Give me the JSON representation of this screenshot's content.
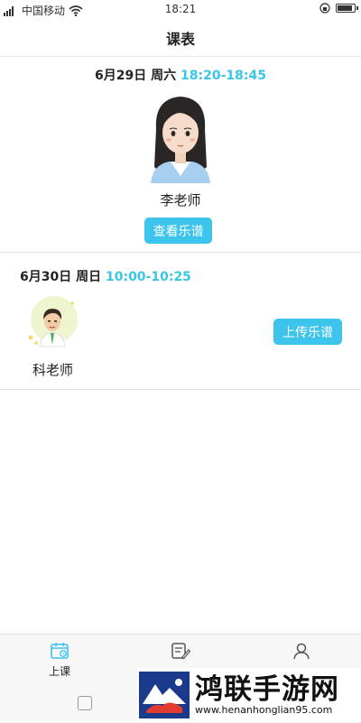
{
  "status": {
    "carrier": "中国移动",
    "time": "18:21"
  },
  "header": {
    "title": "课表"
  },
  "lessons": [
    {
      "date": "6月29日 周六",
      "time": "18:20-18:45",
      "teacher": "李老师",
      "action": "查看乐谱"
    },
    {
      "date": "6月30日 周日",
      "time": "10:00-10:25",
      "teacher": "科老师",
      "action": "上传乐谱"
    }
  ],
  "nav": {
    "items": [
      {
        "label": "上课",
        "icon": "calendar-icon",
        "active": true
      },
      {
        "label": "",
        "icon": "notes-icon",
        "active": false
      },
      {
        "label": "",
        "icon": "profile-icon",
        "active": false
      }
    ]
  },
  "watermark": {
    "title": "鸿联手游网",
    "url": "www.henanhonglian95.com"
  },
  "colors": {
    "accent": "#3cc4ec",
    "time_text": "#38c6e6"
  }
}
